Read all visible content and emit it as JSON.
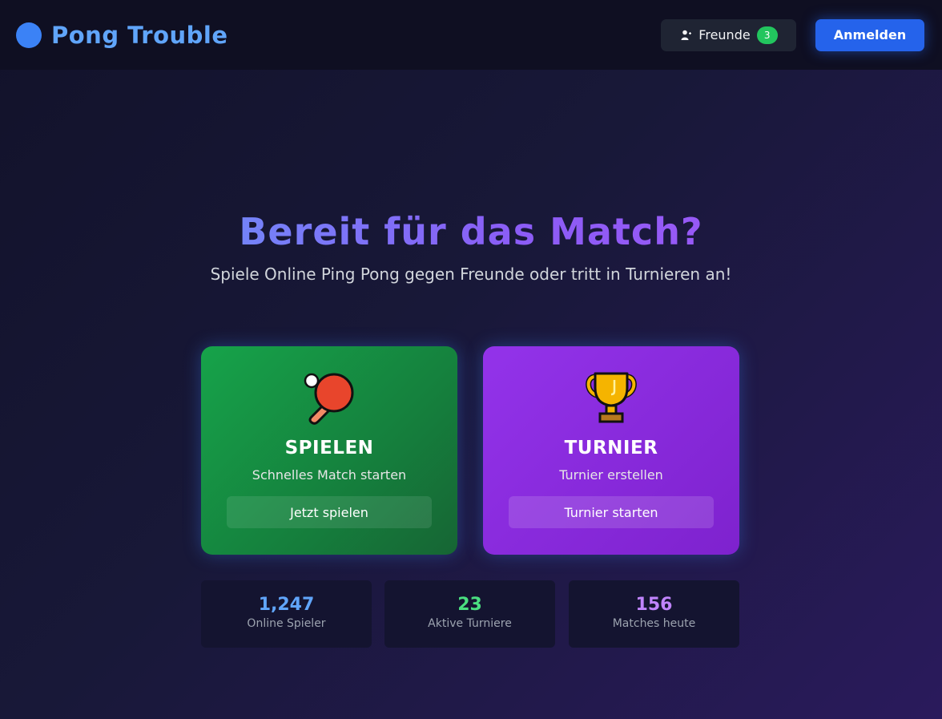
{
  "header": {
    "brand": "Pong Trouble",
    "friends_label": "Freunde",
    "friends_count": "3",
    "login_label": "Anmelden"
  },
  "hero": {
    "title": "Bereit für das Match?",
    "subtitle": "Spiele Online Ping Pong gegen Freunde oder tritt in Turnieren an!"
  },
  "cards": [
    {
      "icon": "ping-pong-paddle-icon",
      "title": "SPIELEN",
      "description": "Schnelles Match starten",
      "button": "Jetzt spielen"
    },
    {
      "icon": "trophy-icon",
      "title": "TURNIER",
      "description": "Turnier erstellen",
      "button": "Turnier starten"
    }
  ],
  "stats": [
    {
      "value": "1,247",
      "label": "Online Spieler",
      "color": "#60a5fa"
    },
    {
      "value": "23",
      "label": "Aktive Turniere",
      "color": "#4ade80"
    },
    {
      "value": "156",
      "label": "Matches heute",
      "color": "#c084fc"
    }
  ],
  "colors": {
    "accent": "#2563eb",
    "play_card": "#16a34a",
    "tournament_card": "#9333ea",
    "badge": "#22c55e"
  }
}
